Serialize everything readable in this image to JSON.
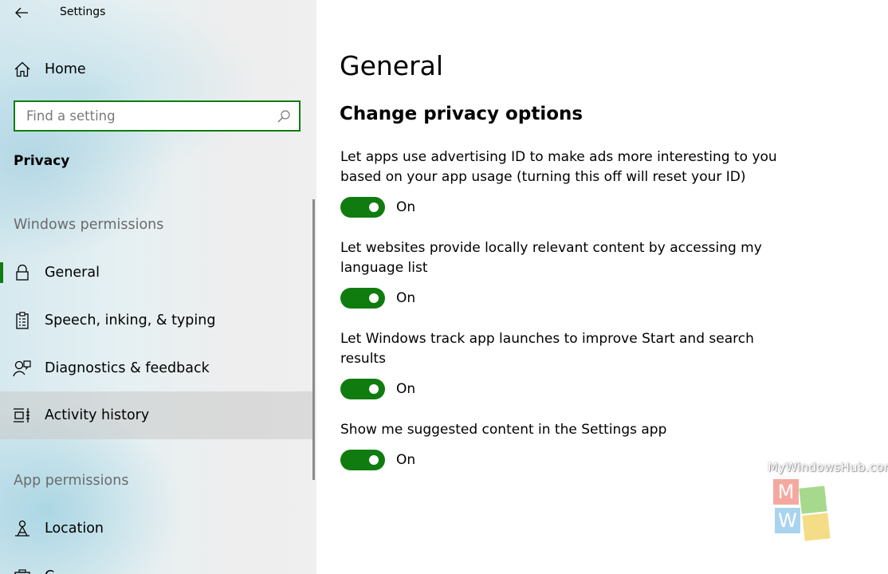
{
  "app": {
    "title": "Settings"
  },
  "sidebar": {
    "home_label": "Home",
    "search": {
      "placeholder": "Find a setting"
    },
    "section_title": "Privacy",
    "groups": [
      {
        "header": "Windows permissions"
      },
      {
        "header": "App permissions"
      }
    ],
    "items": [
      {
        "label": "General",
        "icon": "lock-icon",
        "selected": true
      },
      {
        "label": "Speech, inking, & typing",
        "icon": "clipboard-icon"
      },
      {
        "label": "Diagnostics & feedback",
        "icon": "person-feedback-icon"
      },
      {
        "label": "Activity history",
        "icon": "timeline-icon",
        "hovered": true
      },
      {
        "label": "Location",
        "icon": "location-person-icon"
      },
      {
        "label": "C",
        "icon": "camera-icon"
      }
    ]
  },
  "main": {
    "title": "General",
    "section_title": "Change privacy options",
    "settings": [
      {
        "description": "Let apps use advertising ID to make ads more interesting to you based on your app usage (turning this off will reset your ID)",
        "state": "On"
      },
      {
        "description": "Let websites provide locally relevant content by accessing my language list",
        "state": "On"
      },
      {
        "description": "Let Windows track app launches to improve Start and search results",
        "state": "On"
      },
      {
        "description": "Show me suggested content in the Settings app",
        "state": "On"
      }
    ]
  },
  "watermark": {
    "text": "MyWindowsHub.com",
    "letters": [
      "M",
      "W"
    ]
  },
  "colors": {
    "accent": "#107c10",
    "sidebar_bg": "#e6f0f2",
    "header_gray": "#6b6b6b"
  }
}
